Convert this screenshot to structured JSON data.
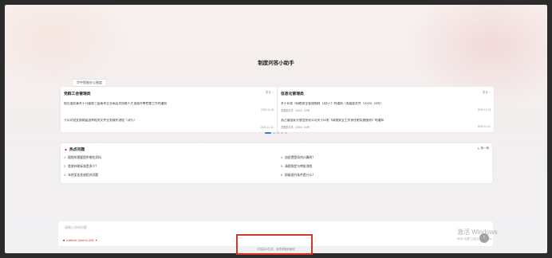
{
  "app": {
    "title": "制度问答小助手"
  },
  "category_tab": "华中智能办公制度",
  "cards": [
    {
      "title": "党群工会管理类",
      "more": "更多 ›",
      "items": [
        {
          "title": "规范落实事关于开展第三届青年企业高层次技能人才选拔评审检查工作的通知",
          "sub": "",
          "date": "2025-11-16"
        },
        {
          "title": "子公司党支部换届选举相关文件业务操作流程（试行）",
          "sub": "",
          "date": "2025-10-22"
        }
      ]
    },
    {
      "title": "信息化管理类",
      "more": "更多 ›",
      "items": [
        {
          "title": "关于印发《网络安全管理细则（试行）》的通知（发展部文件〔2023〕23号）",
          "sub": "发展部文件〔2023〕23号",
          "date": "2025-12-03"
        },
        {
          "title": "浙江省国家开放信息化公司关于印发《网络安全工作责任制实施细则》的通知",
          "sub": "发展部文件〔2024〕54号",
          "date": "2025-10-22"
        }
      ]
    }
  ],
  "hot": {
    "title": "热点问题",
    "refresh": "换一换",
    "questions": [
      {
        "n": "1",
        "text": "报销时需要提供哪些资料"
      },
      {
        "n": "2",
        "text": "差旅补助标准是多少？"
      },
      {
        "n": "3",
        "text": "年终奖金发放相关问题"
      },
      {
        "n": "4",
        "text": "加班费是如何计算的？"
      },
      {
        "n": "5",
        "text": "请假规定与审批流程"
      },
      {
        "n": "6",
        "text": "职级晋升条件是什么？"
      }
    ]
  },
  "input": {
    "placeholder": "请输入你的问题",
    "model": "Institute Qwen3-32B"
  },
  "disclaimer": "内容由AI生成，请谨慎甄别使用",
  "watermark": {
    "line1": "激活 Windows",
    "line2": "转到“设置”以激活 Windows。"
  },
  "colors": {
    "accent": "#3a77e8",
    "brand_red": "#d9322a"
  }
}
